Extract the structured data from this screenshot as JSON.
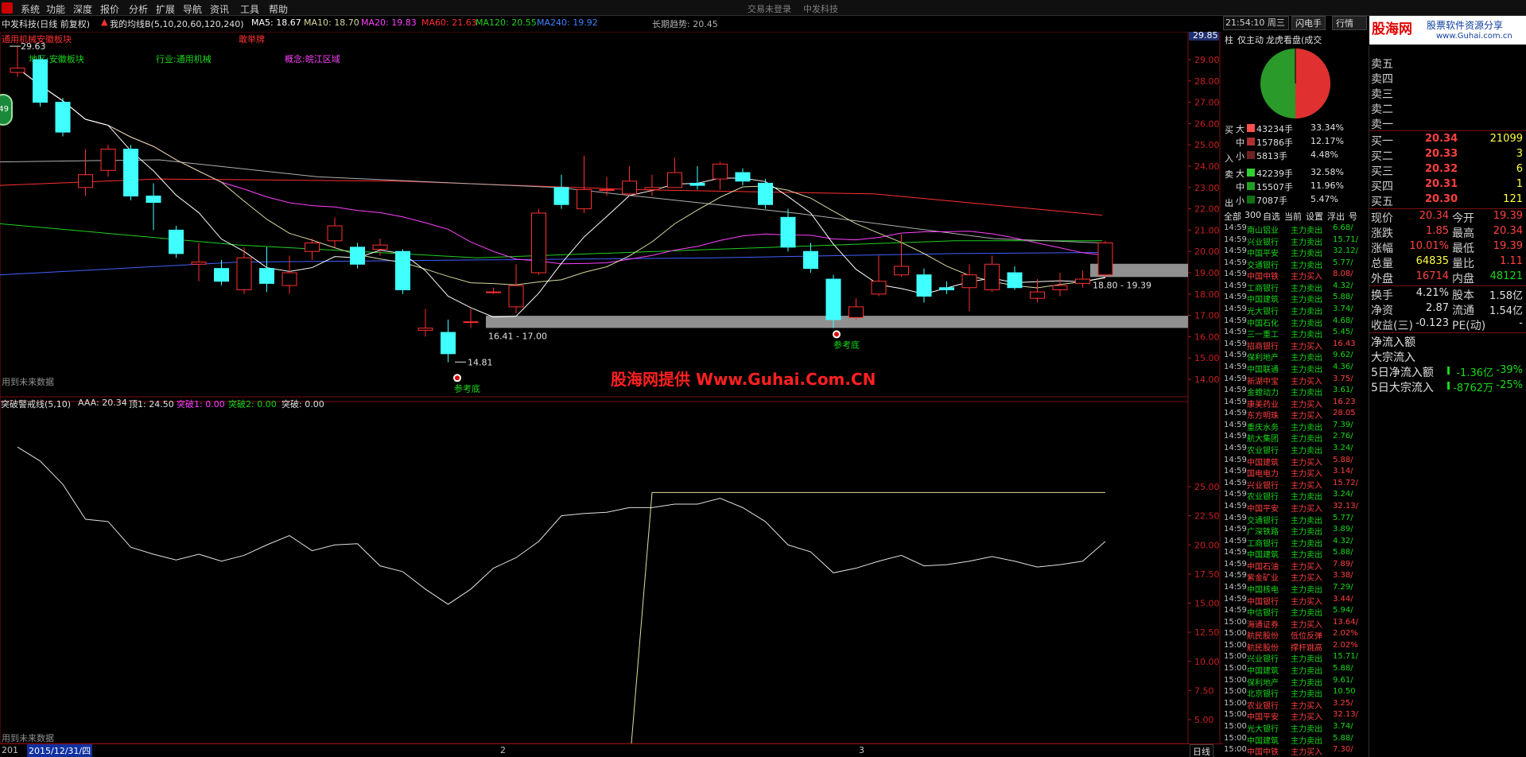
{
  "menubar": {
    "items": [
      "系统",
      "功能",
      "深度",
      "报价",
      "分析",
      "扩展",
      "导航",
      "资讯",
      "工具",
      "帮助"
    ],
    "center_status": "交易未登录",
    "center_title": "中发科技"
  },
  "stock_header": {
    "name_period": "中发科技(日线 前复权)",
    "indicator_name": "我的均线B(5,10,20,60,120,240)",
    "ma5": "MA5: 18.67",
    "ma10": "MA10: 18.70",
    "ma20": "MA20: 19.83",
    "ma60": "MA60: 21.63",
    "ma120": "MA120: 20.55",
    "ma240": "MA240: 19.92",
    "long_trend": "长期趋势: 20.45",
    "sector_line": "通用机械安徽板块",
    "tag": "敢举牌",
    "region": "地区:安徽板块",
    "industry": "行业:通用机械",
    "concept": "概念:皖江区域"
  },
  "colors": {
    "up": "#ff3030",
    "down": "#40ffff",
    "ma5": "#ffffff",
    "ma10": "#d8d8a0",
    "ma20": "#ff40ff",
    "ma60": "#ff3030",
    "ma120": "#20d020",
    "ma240": "#4060ff",
    "longtrend": "#b0b0b0"
  },
  "kchart": {
    "price_axis": [
      "29.00",
      "28.00",
      "27.00",
      "26.00",
      "25.00",
      "24.00",
      "23.00",
      "22.00",
      "21.00",
      "20.00",
      "19.00",
      "18.00",
      "17.00",
      "16.00",
      "15.00",
      "14.00"
    ],
    "current_price_box": "29.85",
    "hi_label": "29.63",
    "lo_label": "14.81",
    "range1": "16.41 - 17.00",
    "range2": "18.80 - 19.39",
    "ref_bottom": "参考底",
    "future_data": "用到未来数据",
    "badge": "49",
    "watermark": "股海网提供  Www.Guhai.Com.CN",
    "candles": [
      {
        "o": 28.4,
        "c": 28.6,
        "h": 29.6,
        "l": 28.2
      },
      {
        "o": 29.0,
        "c": 27.0,
        "h": 29.2,
        "l": 26.8
      },
      {
        "o": 27.0,
        "c": 25.6,
        "h": 27.2,
        "l": 25.4
      },
      {
        "o": 23.0,
        "c": 23.6,
        "h": 24.8,
        "l": 22.6
      },
      {
        "o": 23.8,
        "c": 24.8,
        "h": 25.0,
        "l": 23.5
      },
      {
        "o": 24.8,
        "c": 22.6,
        "h": 25.0,
        "l": 22.4
      },
      {
        "o": 22.6,
        "c": 22.3,
        "h": 23.2,
        "l": 21.0
      },
      {
        "o": 21.0,
        "c": 19.9,
        "h": 21.2,
        "l": 19.7
      },
      {
        "o": 19.4,
        "c": 19.5,
        "h": 20.4,
        "l": 18.6
      },
      {
        "o": 19.2,
        "c": 18.6,
        "h": 19.6,
        "l": 18.4
      },
      {
        "o": 18.2,
        "c": 19.7,
        "h": 20.2,
        "l": 18.0
      },
      {
        "o": 19.2,
        "c": 18.5,
        "h": 20.2,
        "l": 18.1
      },
      {
        "o": 18.4,
        "c": 19.0,
        "h": 19.8,
        "l": 18.0
      },
      {
        "o": 20.0,
        "c": 20.4,
        "h": 20.6,
        "l": 19.6
      },
      {
        "o": 20.5,
        "c": 21.2,
        "h": 21.6,
        "l": 20.2
      },
      {
        "o": 20.2,
        "c": 19.4,
        "h": 20.4,
        "l": 19.2
      },
      {
        "o": 20.1,
        "c": 20.3,
        "h": 20.6,
        "l": 19.8
      },
      {
        "o": 20.0,
        "c": 18.2,
        "h": 20.1,
        "l": 18.0
      },
      {
        "o": 16.3,
        "c": 16.4,
        "h": 17.3,
        "l": 16.0
      },
      {
        "o": 16.2,
        "c": 15.2,
        "h": 16.8,
        "l": 14.8
      },
      {
        "o": 16.7,
        "c": 16.7,
        "h": 17.3,
        "l": 16.4
      },
      {
        "o": 18.1,
        "c": 18.1,
        "h": 18.3,
        "l": 18.0
      },
      {
        "o": 17.4,
        "c": 18.4,
        "h": 19.4,
        "l": 17.1
      },
      {
        "o": 19.0,
        "c": 21.8,
        "h": 22.0,
        "l": 18.9
      },
      {
        "o": 23.0,
        "c": 22.2,
        "h": 23.6,
        "l": 22.0
      },
      {
        "o": 22.0,
        "c": 22.9,
        "h": 24.5,
        "l": 21.8
      },
      {
        "o": 22.9,
        "c": 22.9,
        "h": 23.5,
        "l": 22.6
      },
      {
        "o": 22.7,
        "c": 23.3,
        "h": 24.0,
        "l": 22.6
      },
      {
        "o": 22.9,
        "c": 23.0,
        "h": 23.6,
        "l": 22.6
      },
      {
        "o": 23.0,
        "c": 23.7,
        "h": 24.4,
        "l": 23.0
      },
      {
        "o": 23.2,
        "c": 23.1,
        "h": 24.0,
        "l": 22.9
      },
      {
        "o": 23.4,
        "c": 24.1,
        "h": 24.2,
        "l": 22.9
      },
      {
        "o": 23.7,
        "c": 23.3,
        "h": 23.9,
        "l": 23.1
      },
      {
        "o": 23.2,
        "c": 22.2,
        "h": 23.4,
        "l": 22.0
      },
      {
        "o": 21.6,
        "c": 20.2,
        "h": 22.0,
        "l": 20.0
      },
      {
        "o": 20.0,
        "c": 19.2,
        "h": 20.4,
        "l": 19.0
      },
      {
        "o": 18.7,
        "c": 16.8,
        "h": 18.9,
        "l": 16.4
      },
      {
        "o": 16.9,
        "c": 17.4,
        "h": 17.8,
        "l": 16.8
      },
      {
        "o": 18.0,
        "c": 18.6,
        "h": 19.8,
        "l": 17.9
      },
      {
        "o": 18.9,
        "c": 19.3,
        "h": 20.8,
        "l": 18.8
      },
      {
        "o": 18.9,
        "c": 17.9,
        "h": 19.2,
        "l": 17.6
      },
      {
        "o": 18.3,
        "c": 18.2,
        "h": 18.6,
        "l": 18.0
      },
      {
        "o": 18.3,
        "c": 18.9,
        "h": 19.4,
        "l": 17.2
      },
      {
        "o": 18.2,
        "c": 19.4,
        "h": 19.8,
        "l": 18.1
      },
      {
        "o": 19.0,
        "c": 18.3,
        "h": 19.3,
        "l": 18.2
      },
      {
        "o": 17.8,
        "c": 18.1,
        "h": 18.7,
        "l": 17.6
      },
      {
        "o": 18.2,
        "c": 18.4,
        "h": 19.0,
        "l": 17.9
      },
      {
        "o": 18.5,
        "c": 18.7,
        "h": 19.1,
        "l": 18.3
      },
      {
        "o": 18.9,
        "c": 20.4,
        "h": 20.5,
        "l": 18.8
      }
    ]
  },
  "subchart": {
    "title": "突破警戒线(5,10)",
    "aaa": "AAA: 20.34",
    "top1": "顶1: 24.50",
    "break1": "突破1: 0.00",
    "break2": "突破2: 0.00",
    "break0": "突破: 0.00",
    "axis": [
      "25.00",
      "22.50",
      "20.00",
      "17.50",
      "15.00",
      "12.50",
      "10.00",
      "7.50",
      "5.00"
    ],
    "future_data": "用到未来数据",
    "aaa_values": [
      28.4,
      27.2,
      25.2,
      22.2,
      22.0,
      19.8,
      19.2,
      18.7,
      19.2,
      18.6,
      19.1,
      20.0,
      20.8,
      19.5,
      20.0,
      20.1,
      18.2,
      17.7,
      16.2,
      14.9,
      16.2,
      18.0,
      18.9,
      20.3,
      22.5,
      22.7,
      22.8,
      23.2,
      23.2,
      23.5,
      23.5,
      24.0,
      23.2,
      22.0,
      20.0,
      19.4,
      17.6,
      18.0,
      18.6,
      19.1,
      18.2,
      18.3,
      18.6,
      19.0,
      18.6,
      18.1,
      18.3,
      18.6,
      20.3
    ],
    "top_value": 24.5,
    "top_start_index": 28
  },
  "bottom": {
    "date_cursor": "2015/12/31/四",
    "prefix": "201",
    "month2": "2",
    "month3": "3",
    "period": "日线"
  },
  "right": {
    "clock": "21:54:10 周三",
    "tabs": [
      "闪电手",
      "行情"
    ],
    "brand": "股海网",
    "brand_sub": "股票软件资源分享",
    "brand_url": "www.Guhai.com.cn",
    "side_tabs": [
      "柱",
      "仅主动",
      "龙虎看盘(成交"
    ],
    "pie": {
      "buy_pct": 49.98,
      "sell_pct": 50.02
    },
    "buy_label": [
      "买",
      "入"
    ],
    "sell_label": [
      "卖",
      "出"
    ],
    "flow_buy": [
      {
        "size": "大",
        "vol": "43234手",
        "pct": "33.34%"
      },
      {
        "size": "中",
        "vol": "15786手",
        "pct": "12.17%"
      },
      {
        "size": "小",
        "vol": "5813手",
        "pct": "4.48%"
      }
    ],
    "flow_sell": [
      {
        "size": "大",
        "vol": "42239手",
        "pct": "32.58%"
      },
      {
        "size": "中",
        "vol": "15507手",
        "pct": "11.96%"
      },
      {
        "size": "小",
        "vol": "7087手",
        "pct": "5.47%"
      }
    ],
    "filter_bar": [
      "全部",
      "300",
      "自选",
      "当前",
      "设置",
      "浮出",
      "号"
    ],
    "deals": [
      {
        "t": "14:59",
        "n": "南山铝业",
        "a": "主力卖出",
        "v": "6.68/"
      },
      {
        "t": "14:59",
        "n": "兴业银行",
        "a": "主力卖出",
        "v": "15.71/"
      },
      {
        "t": "14:59",
        "n": "中国平安",
        "a": "主力卖出",
        "v": "32.12/"
      },
      {
        "t": "14:59",
        "n": "交通银行",
        "a": "主力卖出",
        "v": "5.77/"
      },
      {
        "t": "14:59",
        "n": "中国中铁",
        "a": "主力买入",
        "v": "8.08/"
      },
      {
        "t": "14:59",
        "n": "工商银行",
        "a": "主力卖出",
        "v": "4.32/"
      },
      {
        "t": "14:59",
        "n": "中国建筑",
        "a": "主力卖出",
        "v": "5.88/"
      },
      {
        "t": "14:59",
        "n": "光大银行",
        "a": "主力卖出",
        "v": "3.74/"
      },
      {
        "t": "14:59",
        "n": "中国石化",
        "a": "主力卖出",
        "v": "4.68/"
      },
      {
        "t": "14:59",
        "n": "三一重工",
        "a": "主力卖出",
        "v": "5.45/"
      },
      {
        "t": "14:59",
        "n": "招商银行",
        "a": "主力买入",
        "v": "16.43"
      },
      {
        "t": "14:59",
        "n": "保利地产",
        "a": "主力卖出",
        "v": "9.62/"
      },
      {
        "t": "14:59",
        "n": "中国联通",
        "a": "主力卖出",
        "v": "4.36/"
      },
      {
        "t": "14:59",
        "n": "新湖中宝",
        "a": "主力买入",
        "v": "3.75/"
      },
      {
        "t": "14:59",
        "n": "金螳动力",
        "a": "主力卖出",
        "v": "3.61/"
      },
      {
        "t": "14:59",
        "n": "康美药业",
        "a": "主力买入",
        "v": "16.23"
      },
      {
        "t": "14:59",
        "n": "东方明珠",
        "a": "主力买入",
        "v": "28.05"
      },
      {
        "t": "14:59",
        "n": "重庆水务",
        "a": "主力卖出",
        "v": "7.39/"
      },
      {
        "t": "14:59",
        "n": "航大集团",
        "a": "主力卖出",
        "v": "2.76/"
      },
      {
        "t": "14:59",
        "n": "农业银行",
        "a": "主力卖出",
        "v": "3.24/"
      },
      {
        "t": "14:59",
        "n": "中国建筑",
        "a": "主力买入",
        "v": "5.88/"
      },
      {
        "t": "14:59",
        "n": "国电电力",
        "a": "主力买入",
        "v": "3.14/"
      },
      {
        "t": "14:59",
        "n": "兴业银行",
        "a": "主力买入",
        "v": "15.72/"
      },
      {
        "t": "14:59",
        "n": "农业银行",
        "a": "主力卖出",
        "v": "3.24/"
      },
      {
        "t": "14:59",
        "n": "中国平安",
        "a": "主力买入",
        "v": "32.13/"
      },
      {
        "t": "14:59",
        "n": "交通银行",
        "a": "主力卖出",
        "v": "5.77/"
      },
      {
        "t": "14:59",
        "n": "广深铁路",
        "a": "主力卖出",
        "v": "3.89/"
      },
      {
        "t": "14:59",
        "n": "工商银行",
        "a": "主力卖出",
        "v": "4.32/"
      },
      {
        "t": "14:59",
        "n": "中国建筑",
        "a": "主力卖出",
        "v": "5.88/"
      },
      {
        "t": "14:59",
        "n": "中国石油",
        "a": "主力买入",
        "v": "7.89/"
      },
      {
        "t": "14:59",
        "n": "紫金矿业",
        "a": "主力买入",
        "v": "3.38/"
      },
      {
        "t": "14:59",
        "n": "中国核电",
        "a": "主力卖出",
        "v": "7.29/"
      },
      {
        "t": "14:59",
        "n": "中国银行",
        "a": "主力买入",
        "v": "3.44/"
      },
      {
        "t": "14:59",
        "n": "中信银行",
        "a": "主力卖出",
        "v": "5.94/"
      },
      {
        "t": "15:00",
        "n": "海通证券",
        "a": "主力买入",
        "v": "13.64/"
      },
      {
        "t": "15:00",
        "n": "航民股份",
        "a": "低位反弹",
        "v": "2.02%"
      },
      {
        "t": "15:00",
        "n": "航民股份",
        "a": "撑杆跳高",
        "v": "2.02%"
      },
      {
        "t": "15:00",
        "n": "兴业银行",
        "a": "主力卖出",
        "v": "15.71/"
      },
      {
        "t": "15:00",
        "n": "中国建筑",
        "a": "主力卖出",
        "v": "5.88/"
      },
      {
        "t": "15:00",
        "n": "保利地产",
        "a": "主力卖出",
        "v": "9.61/"
      },
      {
        "t": "15:00",
        "n": "北京银行",
        "a": "主力卖出",
        "v": "10.50"
      },
      {
        "t": "15:00",
        "n": "农业银行",
        "a": "主力买入",
        "v": "3.25/"
      },
      {
        "t": "15:00",
        "n": "中国平安",
        "a": "主力买入",
        "v": "32.13/"
      },
      {
        "t": "15:00",
        "n": "光大银行",
        "a": "主力卖出",
        "v": "3.74/"
      },
      {
        "t": "15:00",
        "n": "中国建筑",
        "a": "主力卖出",
        "v": "5.88/"
      },
      {
        "t": "15:00",
        "n": "中国中铁",
        "a": "主力买入",
        "v": "7.30/"
      }
    ],
    "order_book": {
      "sell": [
        {
          "label": "卖五",
          "price": "",
          "vol": ""
        },
        {
          "label": "卖四",
          "price": "",
          "vol": ""
        },
        {
          "label": "卖三",
          "price": "",
          "vol": ""
        },
        {
          "label": "卖二",
          "price": "",
          "vol": ""
        },
        {
          "label": "卖一",
          "price": "",
          "vol": ""
        }
      ],
      "buy": [
        {
          "label": "买一",
          "price": "20.34",
          "vol": "21099"
        },
        {
          "label": "买二",
          "price": "20.33",
          "vol": "3"
        },
        {
          "label": "买三",
          "price": "20.32",
          "vol": "6"
        },
        {
          "label": "买四",
          "price": "20.31",
          "vol": "1"
        },
        {
          "label": "买五",
          "price": "20.30",
          "vol": "121"
        }
      ]
    },
    "stats": [
      {
        "l1": "现价",
        "v1": "20.34",
        "c1": "red",
        "l2": "今开",
        "v2": "19.39",
        "c2": "red"
      },
      {
        "l1": "涨跌",
        "v1": "1.85",
        "c1": "red",
        "l2": "最高",
        "v2": "20.34",
        "c2": "red"
      },
      {
        "l1": "涨幅",
        "v1": "10.01%",
        "c1": "red",
        "l2": "最低",
        "v2": "19.39",
        "c2": "red"
      },
      {
        "l1": "总量",
        "v1": "64835",
        "c1": "yellow",
        "l2": "量比",
        "v2": "1.11",
        "c2": "red"
      },
      {
        "l1": "外盘",
        "v1": "16714",
        "c1": "red",
        "l2": "内盘",
        "v2": "48121",
        "c2": "green"
      }
    ],
    "stats2": [
      {
        "l1": "换手",
        "v1": "4.21%",
        "l2": "股本",
        "v2": "1.58亿"
      },
      {
        "l1": "净资",
        "v1": "2.87",
        "l2": "流通",
        "v2": "1.54亿"
      },
      {
        "l1": "收益(三)",
        "v1": "-0.123",
        "l2": "PE(动)",
        "v2": "-"
      }
    ],
    "flows": [
      {
        "label": "净流入额",
        "v1": "",
        "v2": ""
      },
      {
        "label": "大宗流入",
        "v1": "",
        "v2": ""
      },
      {
        "label": "5日净流入额",
        "v1": "-1.36亿",
        "v2": "-39%"
      },
      {
        "label": "5日大宗流入",
        "v1": "-8762万",
        "v2": "-25%"
      }
    ]
  }
}
